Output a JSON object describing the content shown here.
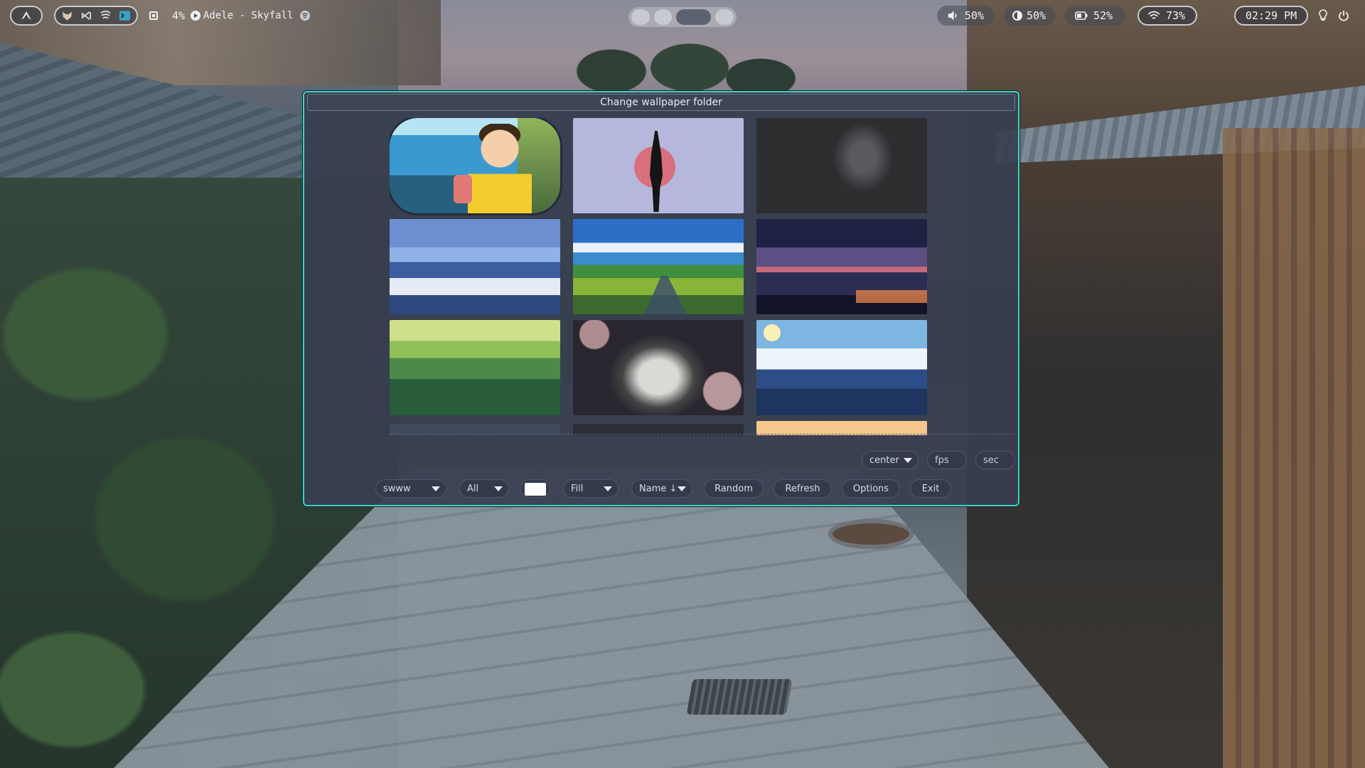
{
  "topbar": {
    "cpu_percent": "4%",
    "media_title": "Adele - Skyfall",
    "volume": "50%",
    "brightness": "50%",
    "battery": "52%",
    "wifi": "73%",
    "clock": "02:29 PM",
    "workspaces": [
      {
        "active": false
      },
      {
        "active": false
      },
      {
        "active": true
      },
      {
        "active": false
      }
    ],
    "icons": {
      "launcher": "arch-logo-icon",
      "apps": [
        "fox-icon",
        "vscode-icon",
        "feed-icon",
        "terminal-icon"
      ],
      "cpu": "cpu-chip-icon",
      "play": "play-icon",
      "spotify": "spotify-icon",
      "volume": "speaker-icon",
      "brightness": "brightness-icon",
      "battery": "battery-icon",
      "wifi": "wifi-icon",
      "bulb": "lightbulb-icon",
      "power": "power-icon"
    }
  },
  "window": {
    "title": "Change wallpaper folder",
    "accent": "#37d7c4",
    "wallpapers": [
      {
        "name": "ghibli-boy-sea"
      },
      {
        "name": "samurai-red-moon"
      },
      {
        "name": "dark-portrait"
      },
      {
        "name": "snowy-mountains-clouds"
      },
      {
        "name": "green-field-path"
      },
      {
        "name": "night-lake-mountains"
      },
      {
        "name": "green-forest-hills"
      },
      {
        "name": "wolf-ink"
      },
      {
        "name": "blue-mountains-sun"
      },
      {
        "name": "partial-row-1"
      },
      {
        "name": "partial-row-2"
      },
      {
        "name": "partial-row-3"
      }
    ]
  },
  "controls": {
    "transition_position": "center",
    "fps_placeholder": "fps",
    "sec_placeholder": "sec",
    "backend": "swww",
    "monitor": "All",
    "color": "#ffffff",
    "fill_mode": "Fill",
    "sort": "Name ↓",
    "random_label": "Random",
    "refresh_label": "Refresh",
    "options_label": "Options",
    "exit_label": "Exit"
  }
}
